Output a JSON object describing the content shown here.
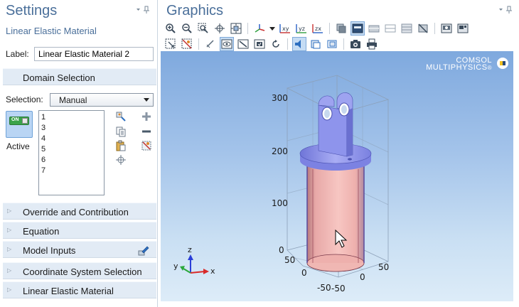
{
  "settings": {
    "title": "Settings",
    "subtitle": "Linear Elastic Material",
    "pin": "▾ ⊥",
    "label_field": {
      "label": "Label:",
      "value": "Linear Elastic Material 2"
    },
    "domain_selection": "Domain Selection",
    "selection": {
      "label": "Selection:",
      "value": "Manual"
    },
    "active_label": "Active",
    "toggle_text": "ON",
    "domains": [
      "1",
      "3",
      "4",
      "5",
      "6",
      "7"
    ],
    "sections": [
      "Override and Contribution",
      "Equation",
      "Model Inputs",
      "Coordinate System Selection",
      "Linear Elastic Material"
    ]
  },
  "graphics": {
    "title": "Graphics",
    "pin": "▾ ⊥",
    "toolbar_labels": {
      "xy": "xy",
      "yz": "yz",
      "zx": "zx"
    },
    "brand_line1": "COMSOL",
    "brand_line2": "MULTIPHYSICS",
    "brand_mark": "®",
    "axis_ticks_z": [
      "300",
      "200",
      "100",
      "0"
    ],
    "axis_ticks_front": [
      "50",
      "0",
      "-50"
    ],
    "axis_ticks_right": [
      "50",
      "0",
      "-50"
    ],
    "triad": {
      "x": "x",
      "y": "y",
      "z": "z"
    }
  },
  "colors": {
    "accent": "#4a6f9a",
    "cylinder": "#f2b6b3",
    "flange": "#9a9ef0",
    "background_top": "#7fa9de",
    "background_bottom": "#ddecf8"
  }
}
